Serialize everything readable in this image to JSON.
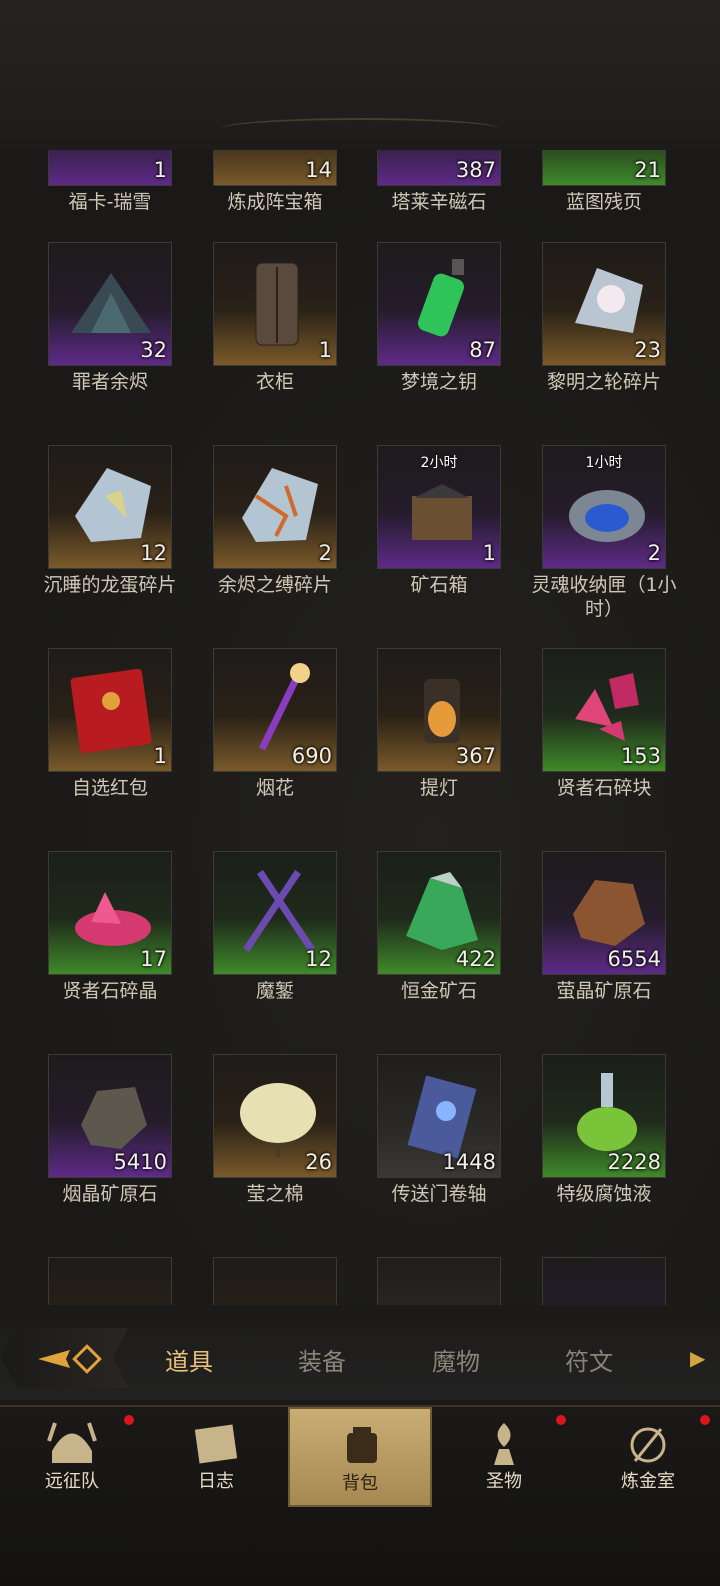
{
  "items": [
    {
      "name": "福卡-瑞雪",
      "count": "1",
      "rarity": "purple",
      "icon": "partial-icon"
    },
    {
      "name": "炼成阵宝箱",
      "count": "14",
      "rarity": "orange",
      "icon": "partial-icon"
    },
    {
      "name": "塔莱辛磁石",
      "count": "387",
      "rarity": "purple",
      "icon": "partial-icon"
    },
    {
      "name": "蓝图残页",
      "count": "21",
      "rarity": "green",
      "icon": "partial-icon"
    },
    {
      "name": "罪者余烬",
      "count": "32",
      "rarity": "purple",
      "icon": "ember-pile-icon"
    },
    {
      "name": "衣柜",
      "count": "1",
      "rarity": "orange",
      "icon": "wardrobe-icon"
    },
    {
      "name": "梦境之钥",
      "count": "87",
      "rarity": "purple",
      "icon": "green-potion-icon"
    },
    {
      "name": "黎明之轮碎片",
      "count": "23",
      "rarity": "orange",
      "icon": "crystal-shard-icon"
    },
    {
      "name": "沉睡的龙蛋碎片",
      "count": "12",
      "rarity": "orange",
      "icon": "egg-shard-icon"
    },
    {
      "name": "余烬之缚碎片",
      "count": "2",
      "rarity": "orange",
      "icon": "cracked-shard-icon"
    },
    {
      "name": "矿石箱",
      "count": "1",
      "rarity": "purple",
      "icon": "ore-crate-icon",
      "timer": "2小时"
    },
    {
      "name": "灵魂收纳匣（1小时）",
      "count": "2",
      "rarity": "purple",
      "icon": "soul-chest-icon",
      "timer": "1小时"
    },
    {
      "name": "自选红包",
      "count": "1",
      "rarity": "orange",
      "icon": "red-envelope-icon"
    },
    {
      "name": "烟花",
      "count": "690",
      "rarity": "orange",
      "icon": "firework-icon"
    },
    {
      "name": "提灯",
      "count": "367",
      "rarity": "orange",
      "icon": "lantern-icon"
    },
    {
      "name": "贤者石碎块",
      "count": "153",
      "rarity": "green",
      "icon": "pink-crystal-icon"
    },
    {
      "name": "贤者石碎晶",
      "count": "17",
      "rarity": "green",
      "icon": "pink-cluster-icon"
    },
    {
      "name": "魔錾",
      "count": "12",
      "rarity": "green",
      "icon": "chisel-icon"
    },
    {
      "name": "恒金矿石",
      "count": "422",
      "rarity": "green",
      "icon": "green-ore-icon"
    },
    {
      "name": "萤晶矿原石",
      "count": "6554",
      "rarity": "purple",
      "icon": "brown-ore-icon"
    },
    {
      "name": "烟晶矿原石",
      "count": "5410",
      "rarity": "purple",
      "icon": "gray-ore-icon"
    },
    {
      "name": "莹之棉",
      "count": "26",
      "rarity": "orange",
      "icon": "cotton-icon"
    },
    {
      "name": "传送门卷轴",
      "count": "1448",
      "rarity": "gray",
      "icon": "scroll-icon"
    },
    {
      "name": "特级腐蚀液",
      "count": "2228",
      "rarity": "green",
      "icon": "poison-flask-icon"
    },
    {
      "name": "",
      "count": "",
      "rarity": "orange",
      "icon": "partial-icon"
    },
    {
      "name": "",
      "count": "",
      "rarity": "orange",
      "icon": "partial-icon"
    },
    {
      "name": "",
      "count": "",
      "rarity": "gray",
      "icon": "partial-icon"
    },
    {
      "name": "",
      "count": "",
      "rarity": "purple",
      "icon": "partial-icon"
    }
  ],
  "tabs": [
    {
      "label": "道具",
      "active": true
    },
    {
      "label": "装备",
      "active": false
    },
    {
      "label": "魔物",
      "active": false
    },
    {
      "label": "符文",
      "active": false
    }
  ],
  "nav": [
    {
      "label": "远征队",
      "icon": "viking-helmet-icon",
      "badge": true,
      "active": false
    },
    {
      "label": "日志",
      "icon": "journal-icon",
      "badge": false,
      "active": false
    },
    {
      "label": "背包",
      "icon": "backpack-icon",
      "badge": false,
      "active": true
    },
    {
      "label": "圣物",
      "icon": "relic-icon",
      "badge": true,
      "active": false
    },
    {
      "label": "炼金室",
      "icon": "alchemy-icon",
      "badge": true,
      "active": false
    }
  ],
  "colors": {
    "accent": "#e8c27a",
    "badge": "#d81818",
    "purple": "#5e2a88",
    "orange": "#7a5a2a",
    "green": "#3f8a2a"
  }
}
